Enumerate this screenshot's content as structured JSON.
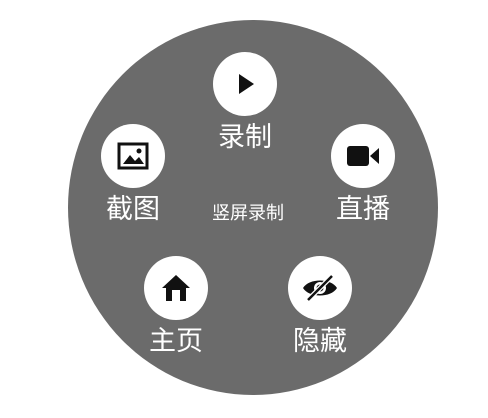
{
  "menu": {
    "center_title": "竖屏录制",
    "items": [
      {
        "id": "record",
        "label": "录制",
        "icon": "play-icon"
      },
      {
        "id": "screenshot",
        "label": "截图",
        "icon": "image-icon"
      },
      {
        "id": "live",
        "label": "直播",
        "icon": "video-camera-icon"
      },
      {
        "id": "home",
        "label": "主页",
        "icon": "home-icon"
      },
      {
        "id": "hide",
        "label": "隐藏",
        "icon": "eye-off-icon"
      }
    ]
  },
  "colors": {
    "menu_background": "#6b6b6b",
    "icon_background": "#ffffff",
    "icon_foreground": "#111111",
    "label_text": "#ffffff"
  }
}
